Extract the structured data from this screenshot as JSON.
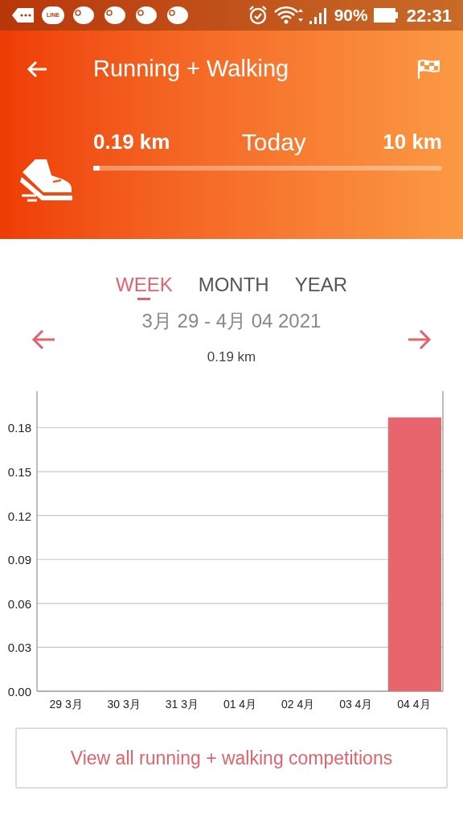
{
  "status_bar": {
    "app_badge": "LINE",
    "battery": "90%",
    "time": "22:31"
  },
  "header": {
    "title": "Running + Walking",
    "current": "0.19 km",
    "period": "Today",
    "goal": "10 km",
    "level": 0.019
  },
  "tabs": [
    {
      "label": "WEEK",
      "selected": true
    },
    {
      "label": "MONTH",
      "selected": false
    },
    {
      "label": "YEAR",
      "selected": false
    }
  ],
  "date_range": "3月 29 - 4月 04 2021",
  "total": "0.19 km",
  "chart_data": {
    "type": "bar",
    "categories": [
      "29 3月",
      "30 3月",
      "31 3月",
      "01 4月",
      "02 4月",
      "03 4月",
      "04 4月"
    ],
    "series": [
      {
        "color": "#e8656e",
        "values": [
          0,
          0,
          0,
          0,
          0,
          0,
          0.187
        ]
      }
    ],
    "grid": true,
    "ylim": [
      0,
      0.205
    ],
    "yticks": [
      {
        "value": 0,
        "label": "0.00"
      },
      {
        "value": 0.03,
        "label": "0.03"
      },
      {
        "value": 0.06,
        "label": "0.06"
      },
      {
        "value": 0.09,
        "label": "0.09"
      },
      {
        "value": 0.12,
        "label": "0.12"
      },
      {
        "value": 0.15,
        "label": "0.15"
      },
      {
        "value": 0.18,
        "label": "0.18"
      }
    ]
  },
  "action_button": "View all running + walking competitions"
}
